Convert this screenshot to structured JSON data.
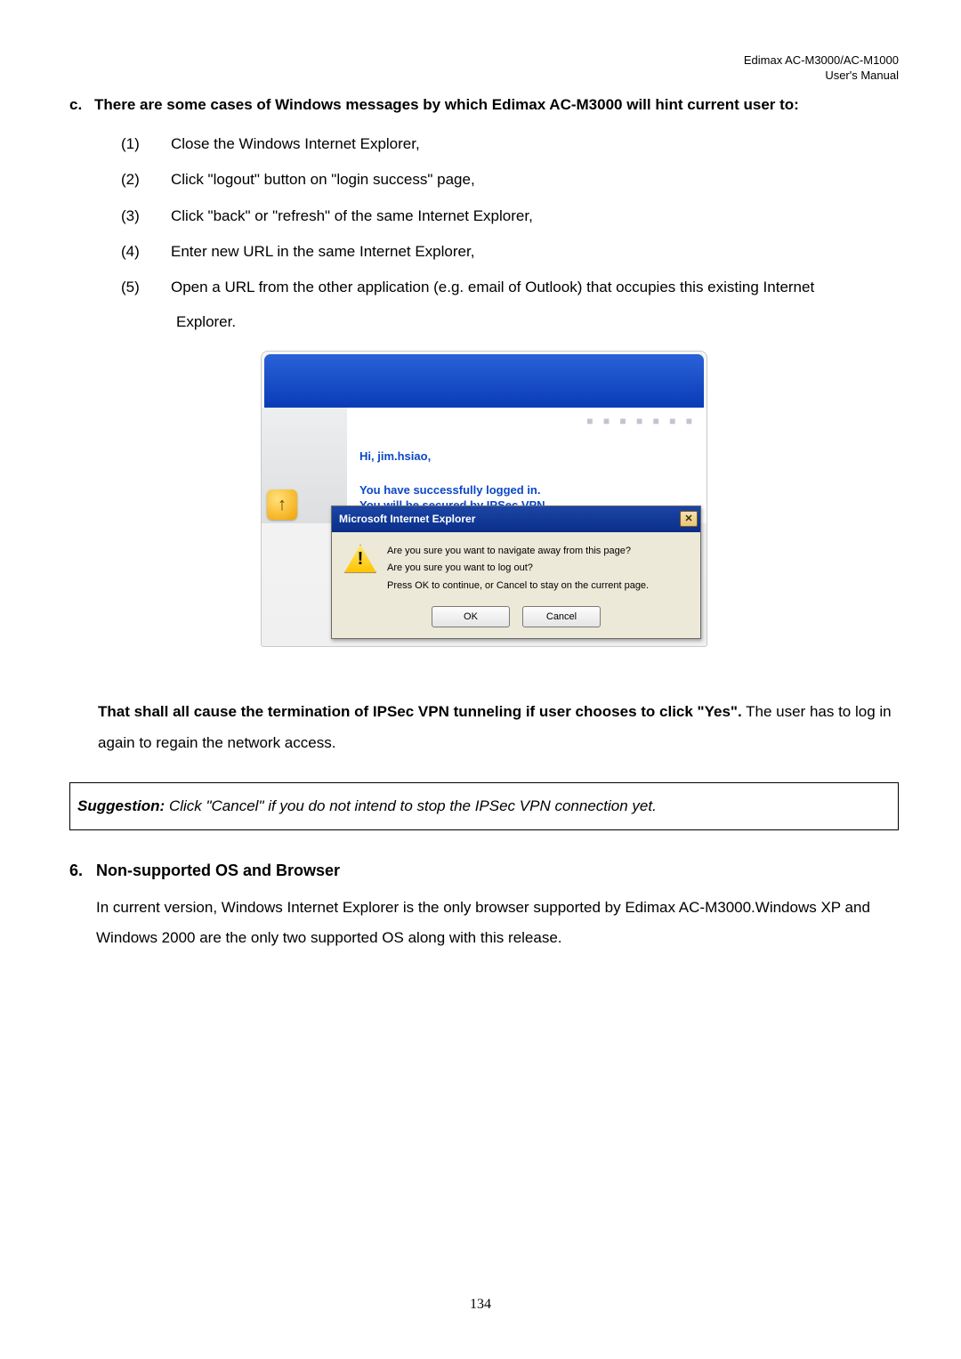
{
  "header": {
    "product": "Edimax  AC-M3000/AC-M1000",
    "doc": "User's  Manual"
  },
  "sectionC": {
    "marker": "c.",
    "title": "There are some cases of Windows messages by which Edimax AC-M3000 will hint current user to:"
  },
  "list": [
    {
      "n": "(1)",
      "t": "Close the Windows Internet Explorer,"
    },
    {
      "n": "(2)",
      "t": "Click \"logout\" button on \"login success\" page,"
    },
    {
      "n": "(3)",
      "t": "Click \"back\" or \"refresh\" of the same Internet Explorer,"
    },
    {
      "n": "(4)",
      "t": "Enter new URL in the same Internet Explorer,"
    },
    {
      "n": "(5)",
      "t": "Open a URL from the other application (e.g. email of Outlook) that occupies this existing Internet",
      "cont": "Explorer."
    }
  ],
  "mock": {
    "greeting": "Hi, jim.hsiao,",
    "line1": "You have successfully logged in.",
    "line2": "You will be secured by IPSec VPN.",
    "icon_glyph": "↑"
  },
  "dialog": {
    "title": "Microsoft Internet Explorer",
    "close": "✕",
    "warn_glyph": "!",
    "q1": "Are you sure you want to navigate away from this page?",
    "q2": "Are you sure you want to log out?",
    "q3": "Press OK to continue, or Cancel to stay on the current page.",
    "ok": "OK",
    "cancel": "Cancel"
  },
  "post": {
    "bold": "That shall all cause the termination of IPSec VPN tunneling if user chooses to click \"Yes\".",
    "rest": " The user has to log in again to regain the network access."
  },
  "suggestion": {
    "lead": "Suggestion:",
    "rest": " Click \"Cancel\" if you do not intend to stop the IPSec VPN connection yet."
  },
  "section6": {
    "marker": "6.",
    "title": "Non-supported OS and Browser",
    "body": "In current version, Windows Internet Explorer is the only browser supported by Edimax AC-M3000.Windows XP and Windows 2000 are the only two supported OS along with this release."
  },
  "page_number": "134"
}
